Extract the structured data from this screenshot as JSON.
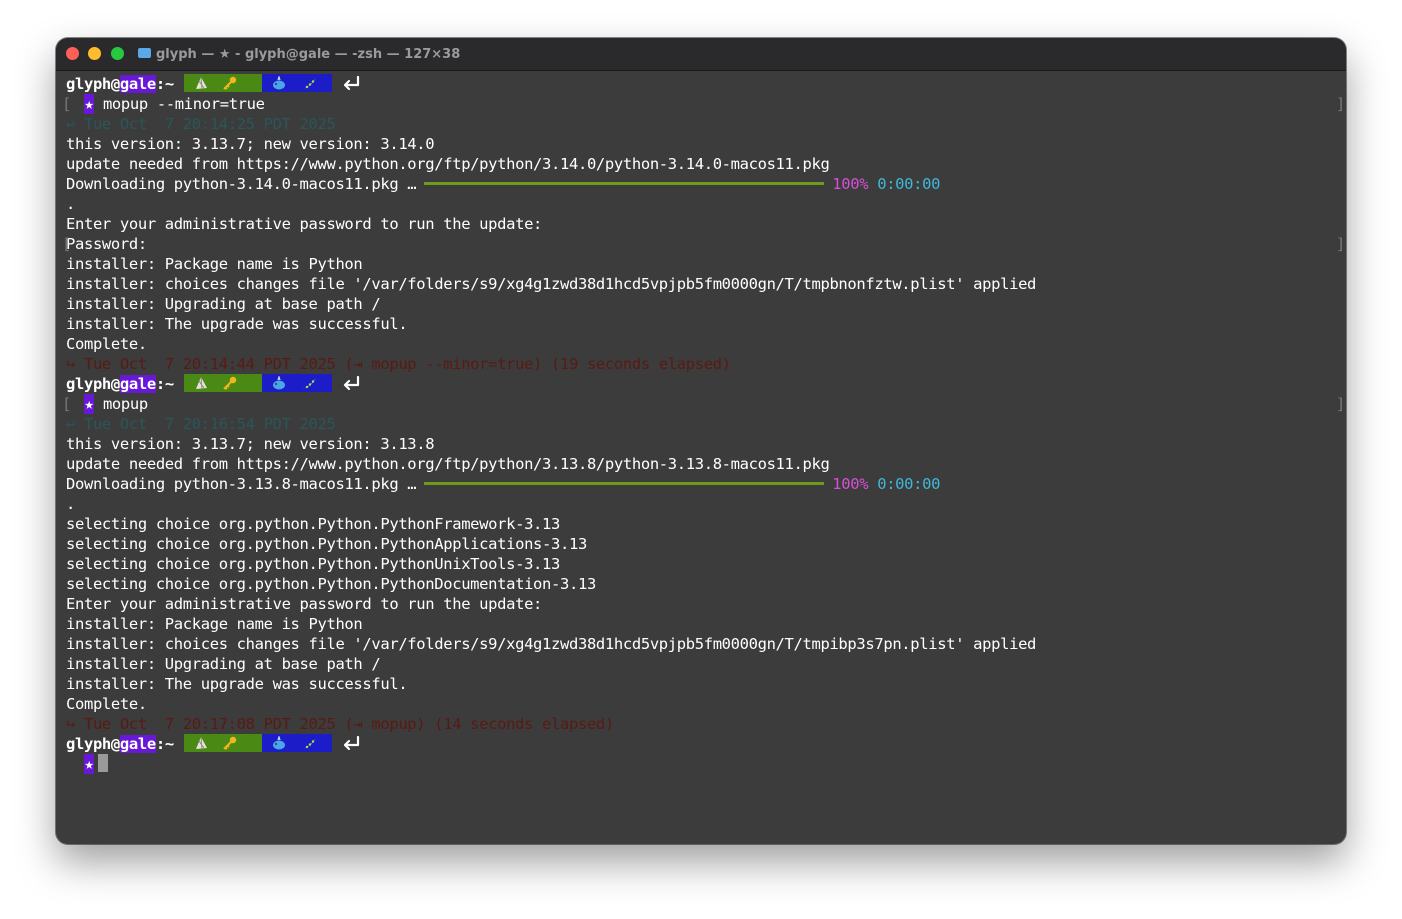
{
  "window": {
    "title": "glyph — ★ - glyph@gale — -zsh — 127×38"
  },
  "colors": {
    "host_bg": "#6a18d8",
    "green_seg": "#4a8a14",
    "blue_seg": "#1c1cc8",
    "progress": "#6f9a1c",
    "percent": "#d64fd6",
    "eta": "#3fb8d8"
  },
  "prompt": {
    "user": "glyph@",
    "host": "gale",
    "path": ":~",
    "star": "★",
    "icons": [
      "shell-icon",
      "key-icon",
      "whale-icon",
      "peapod-icon",
      "return-icon"
    ]
  },
  "session1": {
    "command": "mopup --minor=true",
    "start_ts": "↩ Tue Oct  7 20:14:25 PDT 2025",
    "version_line": "this version: 3.13.7; new version: 3.14.0",
    "update_line": "update needed from https://www.python.org/ftp/python/3.14.0/python-3.14.0-macos11.pkg",
    "download_label": "Downloading python-3.14.0-macos11.pkg …",
    "progress_pct": "100%",
    "progress_eta": "0:00:00",
    "progress_fraction": 1.0,
    "dot": ".",
    "lines": [
      "Enter your administrative password to run the update:",
      "Password:",
      "installer: Package name is Python",
      "installer: choices changes file '/var/folders/s9/xg4g1zwd38d1hcd5vpjpb5fm0000gn/T/tmpbnonfztw.plist' applied",
      "installer: Upgrading at base path /",
      "installer: The upgrade was successful.",
      "Complete."
    ],
    "end_ts": "↪ Tue Oct  7 20:14:44 PDT 2025 (⇥ mopup --minor=true) (19 seconds elapsed)"
  },
  "session2": {
    "command": "mopup",
    "start_ts": "↩ Tue Oct  7 20:16:54 PDT 2025",
    "version_line": "this version: 3.13.7; new version: 3.13.8",
    "update_line": "update needed from https://www.python.org/ftp/python/3.13.8/python-3.13.8-macos11.pkg",
    "download_label": "Downloading python-3.13.8-macos11.pkg …",
    "progress_pct": "100%",
    "progress_eta": "0:00:00",
    "progress_fraction": 1.0,
    "dot": ".",
    "lines": [
      "selecting choice org.python.Python.PythonFramework-3.13",
      "selecting choice org.python.Python.PythonApplications-3.13",
      "selecting choice org.python.Python.PythonUnixTools-3.13",
      "selecting choice org.python.Python.PythonDocumentation-3.13",
      "Enter your administrative password to run the update:",
      "installer: Package name is Python",
      "installer: choices changes file '/var/folders/s9/xg4g1zwd38d1hcd5vpjpb5fm0000gn/T/tmpibp3s7pn.plist' applied",
      "installer: Upgrading at base path /",
      "installer: The upgrade was successful.",
      "Complete."
    ],
    "end_ts": "↪ Tue Oct  7 20:17:08 PDT 2025 (⇥ mopup) (14 seconds elapsed)"
  }
}
